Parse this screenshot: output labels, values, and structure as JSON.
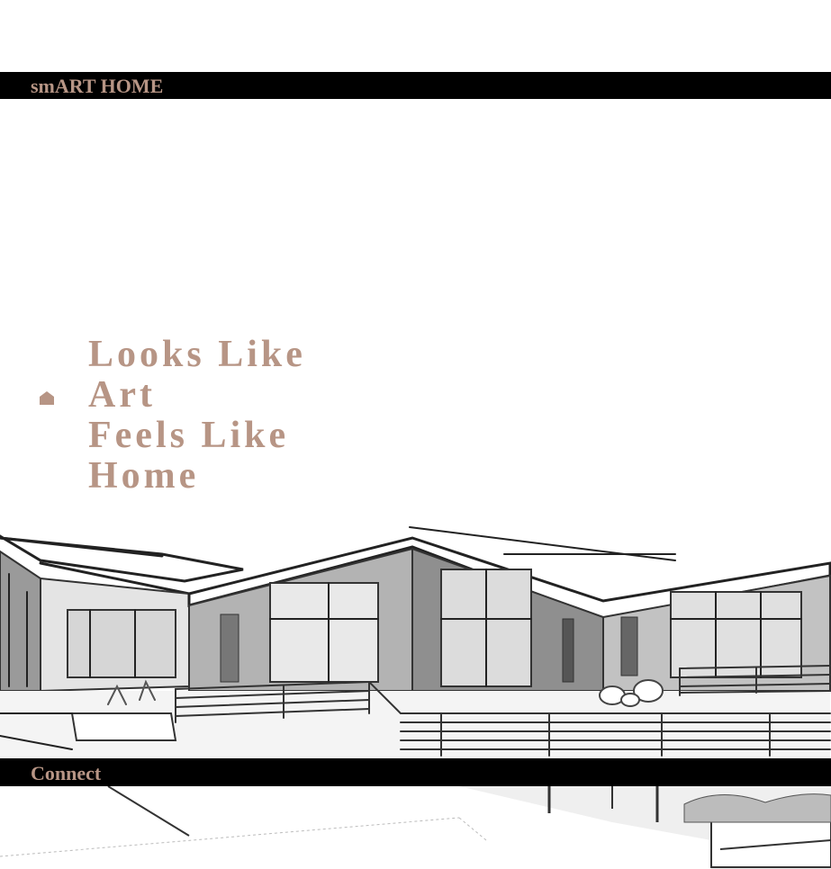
{
  "header": {
    "brand": "smART HOME"
  },
  "hero": {
    "lines": [
      "Looks Like",
      "Art",
      "Feels Like",
      "Home"
    ],
    "icon": "home-icon"
  },
  "footer": {
    "connect_label": "Connect"
  },
  "colors": {
    "accent": "#b79585",
    "bar": "#000000",
    "background": "#ffffff"
  },
  "images": {
    "illustration": "house-sketch-illustration"
  }
}
